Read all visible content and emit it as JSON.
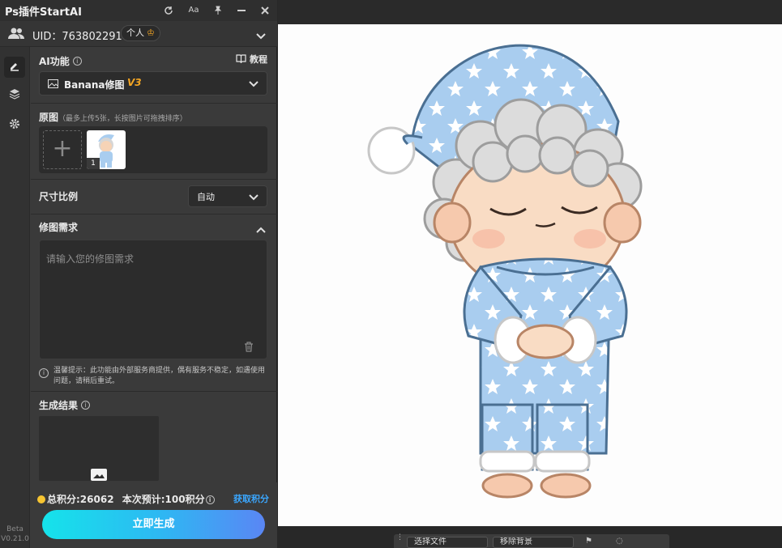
{
  "app": {
    "title": "Ps插件StartAI"
  },
  "titlebar_icons": [
    "refresh-icon",
    "font-size-icon",
    "pin-icon",
    "minimize-icon",
    "close-icon"
  ],
  "titlebar_glyphs": {
    "font": "Aa"
  },
  "user": {
    "uid_text": "UID：763802291",
    "plan": "个人"
  },
  "ai_function": {
    "label": "AI功能",
    "tutorial": "教程",
    "selected": "Banana修图",
    "version": "V3"
  },
  "source_image": {
    "label": "原图",
    "hint": "（最多上传5张，长按图片可拖拽排序）",
    "thumb_index": "1"
  },
  "aspect_ratio": {
    "label": "尺寸比例",
    "value": "自动"
  },
  "edit_request": {
    "label": "修图需求",
    "placeholder": "请输入您的修图需求"
  },
  "notice": "温馨提示：此功能由外部服务商提供，偶有服务不稳定，如遇使用问题，请稍后重试。",
  "result": {
    "label": "生成结果"
  },
  "footer": {
    "total_points": "总积分:26062",
    "estimate": "本次预计:100积分",
    "get_points": "获取积分",
    "generate": "立即生成"
  },
  "version": {
    "beta": "Beta",
    "number": "V0.21.0"
  },
  "taskbar": {
    "select_file": "选择文件",
    "remove_bg": "移除背景"
  },
  "colors": {
    "panel_bg": "#3a3a3a",
    "accent_blue": "#3aa7ff",
    "version_badge": "#f5a623",
    "button_gradient_start": "#15e3ea",
    "button_gradient_end": "#5a86f4",
    "pajama_blue": "#a9cdef"
  }
}
